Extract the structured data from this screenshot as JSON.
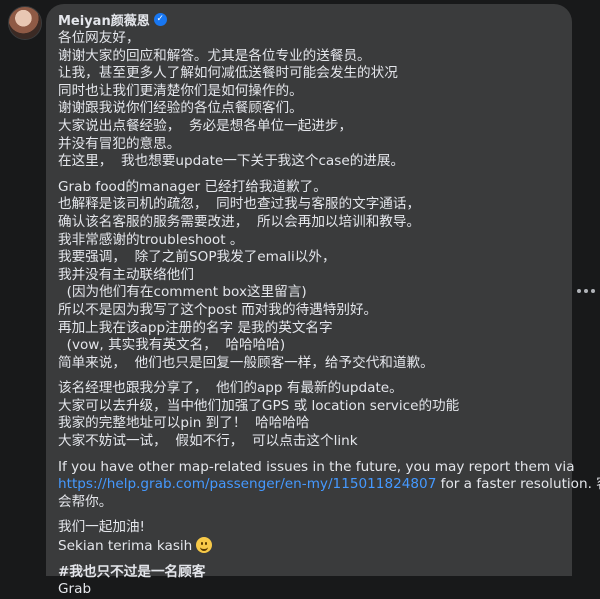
{
  "comment": {
    "author": "Meiyan颜薇恩",
    "verified_icon": "verified-badge-icon",
    "paragraphs": [
      [
        "各位网友好，",
        "谢谢大家的回应和解答。尤其是各位专业的送餐员。",
        "让我，甚至更多人了解如何减低送餐时可能会发生的状况",
        "同时也让我们更清楚你们是如何操作的。",
        "谢谢跟我说你们经验的各位点餐顾客们。",
        "大家说出点餐经验，  务必是想各单位一起进步，",
        "并没有冒犯的意思。",
        "在这里，  我也想要update一下关于我这个case的进展。"
      ],
      [
        "Grab food的manager 已经打给我道歉了。",
        "也解释是该司机的疏忽，  同时也查过我与客服的文字通话，",
        "确认该名客服的服务需要改进，  所以会再加以培训和教导。",
        "我非常感谢的troubleshoot 。",
        "我要强调，  除了之前SOP我发了emali以外，",
        "我并没有主动联络他们",
        "  (因为他们有在comment box这里留言)",
        "所以不是因为我写了这个post 而对我的待遇特别好。",
        "再加上我在该app注册的名字 是我的英文名字",
        "  (vow, 其实我有英文名，  哈哈哈哈)",
        "简单来说，  他们也只是回复一般顾客一样，给予交代和道歉。"
      ],
      [
        "该名经理也跟我分享了，  他们的app 有最新的update。",
        "大家可以去升级，当中他们加强了GPS 或 location service的功能",
        "我家的完整地址可以pin 到了！  哈哈哈哈",
        "大家不妨试一试，  假如不行，  可以点击这个link"
      ]
    ],
    "map_issue_line": "If you have other map-related issues in the future, you may report them via",
    "help_link": "https://help.grab.com/passenger/en-my/115011824807",
    "after_link": " for a faster resolution. 客服",
    "after_link_2": "会帮你。",
    "closing_1": "我们一起加油!",
    "closing_2": "Sekian terima kasih",
    "emoji_icon": "smiling-face-emoji",
    "hashtag": "#我也只不过是一名顾客",
    "signature": "Grab"
  },
  "ui": {
    "more_icon": "more-options-icon",
    "bubble_color": "#3a3b3c",
    "link_color": "#4599ff",
    "background": "#18191a"
  }
}
